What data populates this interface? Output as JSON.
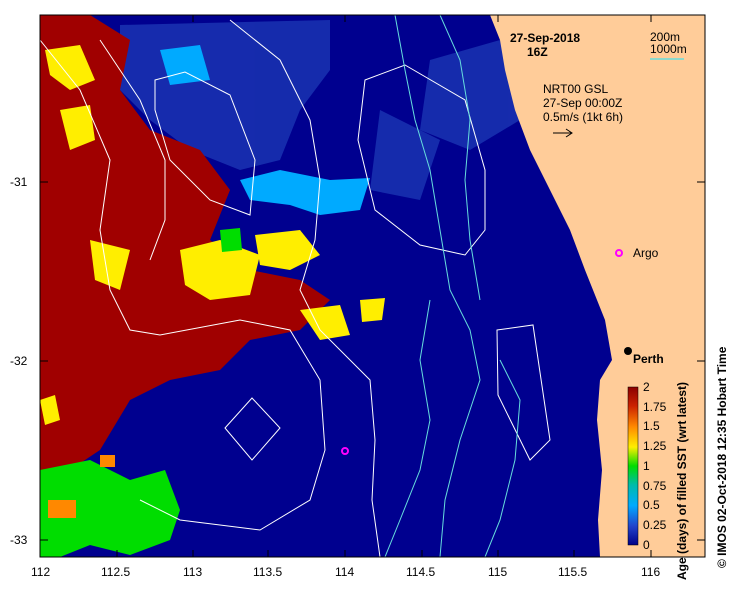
{
  "title": {
    "date": "27-Sep-2018",
    "time": "16Z"
  },
  "depth_legend": {
    "items": [
      {
        "label": "200m",
        "color": "#ffffff"
      },
      {
        "label": "1000m",
        "color": "#66dddd"
      }
    ]
  },
  "current_info": {
    "line1": "NRT00 GSL",
    "line2": "27-Sep 00:00Z",
    "line3": "0.5m/s (1kt 6h)"
  },
  "markers": {
    "argo_label": "Argo",
    "city_label": "Perth"
  },
  "axes": {
    "x_ticks": [
      "112",
      "112.5",
      "113",
      "113.5",
      "114",
      "114.5",
      "115",
      "115.5",
      "116"
    ],
    "y_ticks": [
      "-31",
      "-32",
      "-33"
    ]
  },
  "colorbar": {
    "ticks": [
      "2",
      "1.75",
      "1.5",
      "1.25",
      "1",
      "0.75",
      "0.5",
      "0.25",
      "0"
    ],
    "label": "Age (days) of filled SST (wrt latest)",
    "colors": [
      "#8b0000",
      "#cc2200",
      "#ff8800",
      "#ffee00",
      "#00dd00",
      "#00bbaa",
      "#00aaff",
      "#2244cc",
      "#000088"
    ]
  },
  "credit": "© IMOS 02-Oct-2018 12:35 Hobart Time",
  "palette": {
    "ocean": "#00008f",
    "land": "#ffcc99",
    "age_high": "#a00000",
    "yellow": "#ffee00",
    "cyan": "#00aaff",
    "green": "#00dd00",
    "orange": "#ff8800"
  }
}
